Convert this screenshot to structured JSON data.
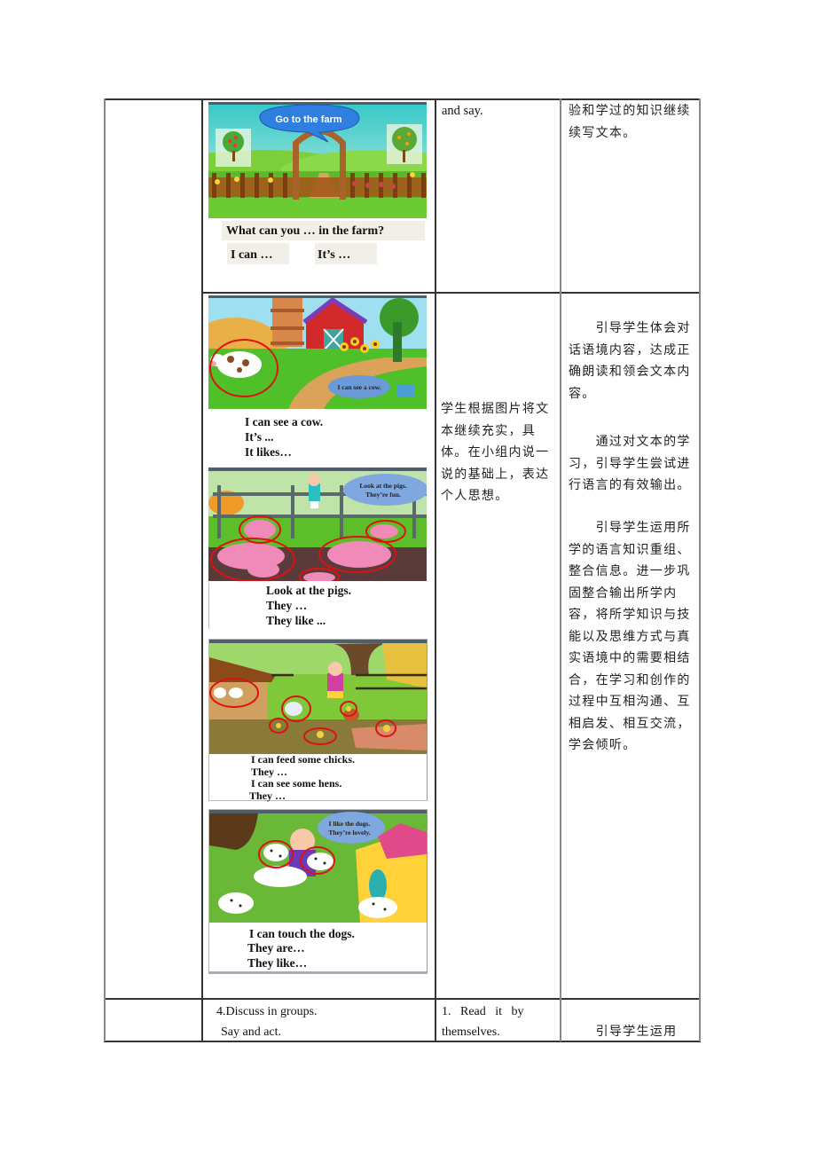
{
  "table": {
    "row1": {
      "images": {
        "slide1": {
          "bubble": "Go to the farm",
          "question": "What can you … in the farm?",
          "prompt_a": "I can …",
          "prompt_b": "It’s …"
        }
      },
      "student_activity": "and say.",
      "design_intent": "验和学过的知识继续续写文本。"
    },
    "row2": {
      "images": {
        "cow": {
          "bubble": "I can see a cow.",
          "lines": [
            "I can see a cow.",
            "It’s ...",
            "It likes…"
          ]
        },
        "pigs": {
          "bubble_line1": "Look at the pigs.",
          "bubble_line2": "They’re fun.",
          "lines": [
            "Look at the pigs.",
            "They …",
            "They like ..."
          ]
        },
        "chicks": {
          "lines": [
            "I can feed some chicks.",
            "They …",
            "I can see some hens.",
            "They …"
          ]
        },
        "dogs": {
          "bubble_line1": "I like the dogs.",
          "bubble_line2": "They’re lovely.",
          "lines": [
            "I can touch the dogs.",
            "They are…",
            "They like…"
          ]
        }
      },
      "student_activity": "学生根据图片将文本继续充实，具体。在小组内说一说的基础上，表达个人思想。",
      "design_intent": [
        "　　引导学生体会对话语境内容，达成正确朗读和领会文本内容。",
        "　　通过对文本的学习，引导学生尝试进行语言的有效输出。",
        "　　引导学生运用所学的语言知识重组、整合信息。进一步巩固整合输出所学内容，将所学知识与技能以及思维方式与真实语境中的需要相结合，在学习和创作的过程中互相沟通、互相启发、相互交流，学会倾听。"
      ]
    },
    "row3": {
      "step_line1": "4.Discuss in groups.",
      "step_line2": "Say and act.",
      "student_line1": "1.   Read   it   by",
      "student_line2": "themselves.",
      "design_intent": "　　引导学生运用"
    }
  }
}
